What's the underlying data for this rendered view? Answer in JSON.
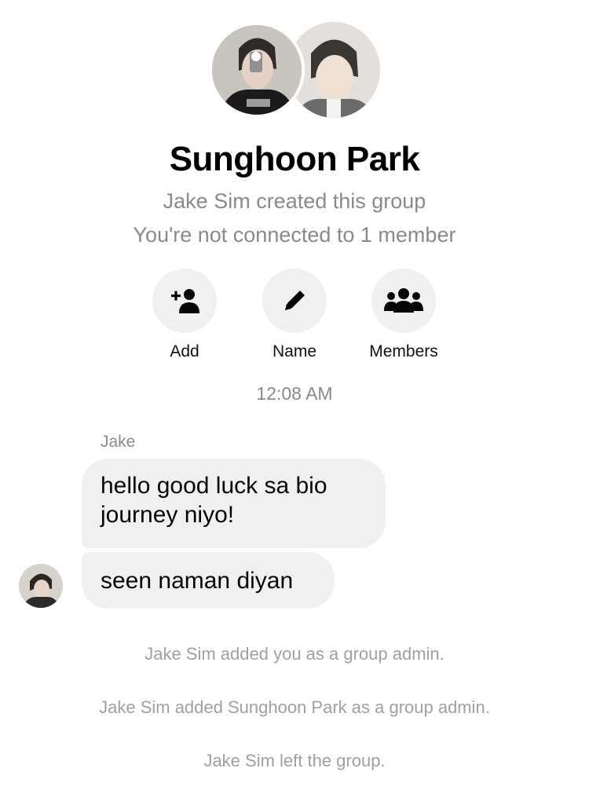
{
  "header": {
    "title": "Sunghoon Park",
    "created_by": "Jake Sim created this group",
    "connection_note": "You're not connected to 1 member"
  },
  "group_avatars": [
    "group-photo-front",
    "group-photo-back"
  ],
  "actions": {
    "add": {
      "label": "Add",
      "icon": "add-person-icon"
    },
    "name": {
      "label": "Name",
      "icon": "pencil-icon"
    },
    "members": {
      "label": "Members",
      "icon": "group-members-icon"
    }
  },
  "conversation": {
    "timestamp": "12:08 AM",
    "sender_name": "Jake",
    "messages": [
      {
        "text": "hello good luck sa bio journey niyo!"
      },
      {
        "text": "seen naman diyan"
      }
    ]
  },
  "system_messages": [
    "Jake Sim added you as a group admin.",
    "Jake Sim added Sunghoon Park as a group admin.",
    "Jake Sim left the group."
  ],
  "colors": {
    "bubble_bg": "#f0f0f0",
    "secondary_text": "#8a8a8e",
    "system_text": "#a0a0a4"
  }
}
